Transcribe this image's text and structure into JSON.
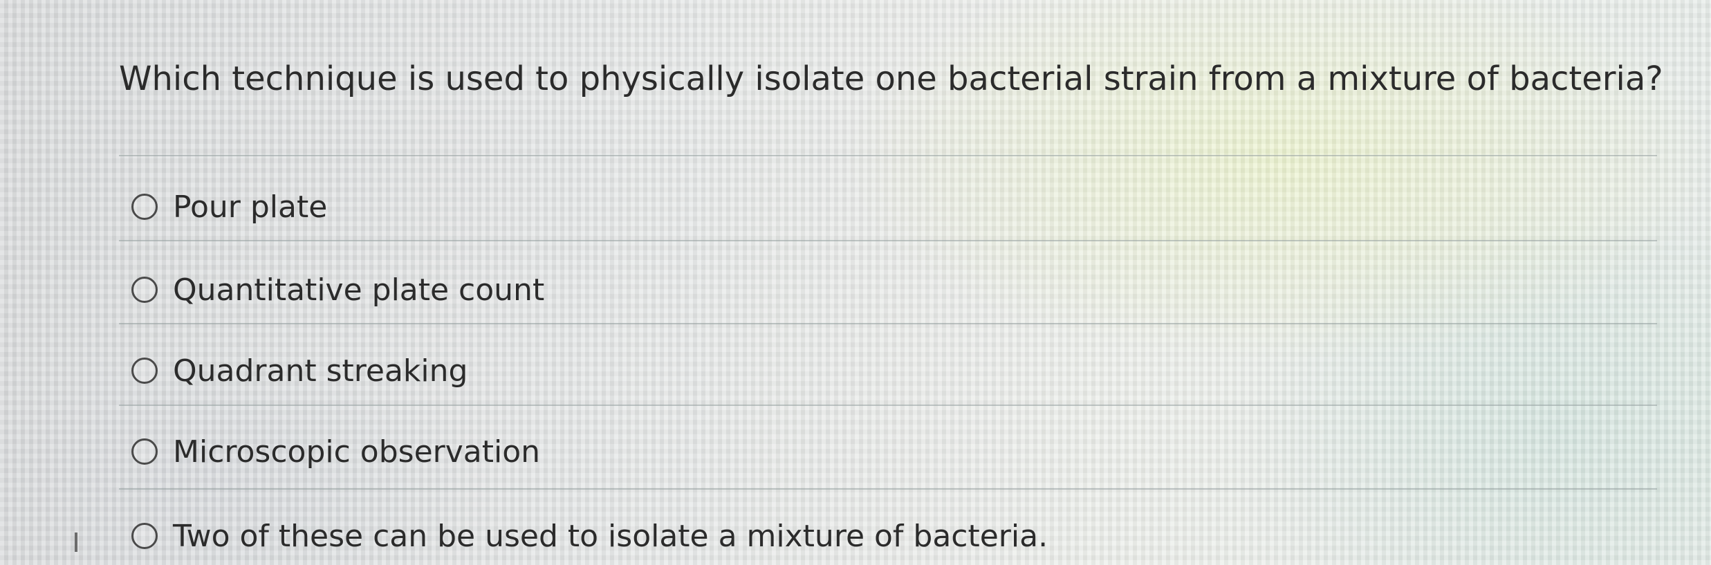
{
  "question": {
    "text": "Which technique is used to physically isolate one bacterial strain from a mixture of bacteria?"
  },
  "options": [
    {
      "label": "Pour plate",
      "selected": false
    },
    {
      "label": "Quantitative plate count",
      "selected": false
    },
    {
      "label": "Quadrant streaking",
      "selected": false
    },
    {
      "label": "Microscopic observation",
      "selected": false
    },
    {
      "label": "Two of these can be used to isolate a mixture of bacteria.",
      "selected": false
    }
  ]
}
